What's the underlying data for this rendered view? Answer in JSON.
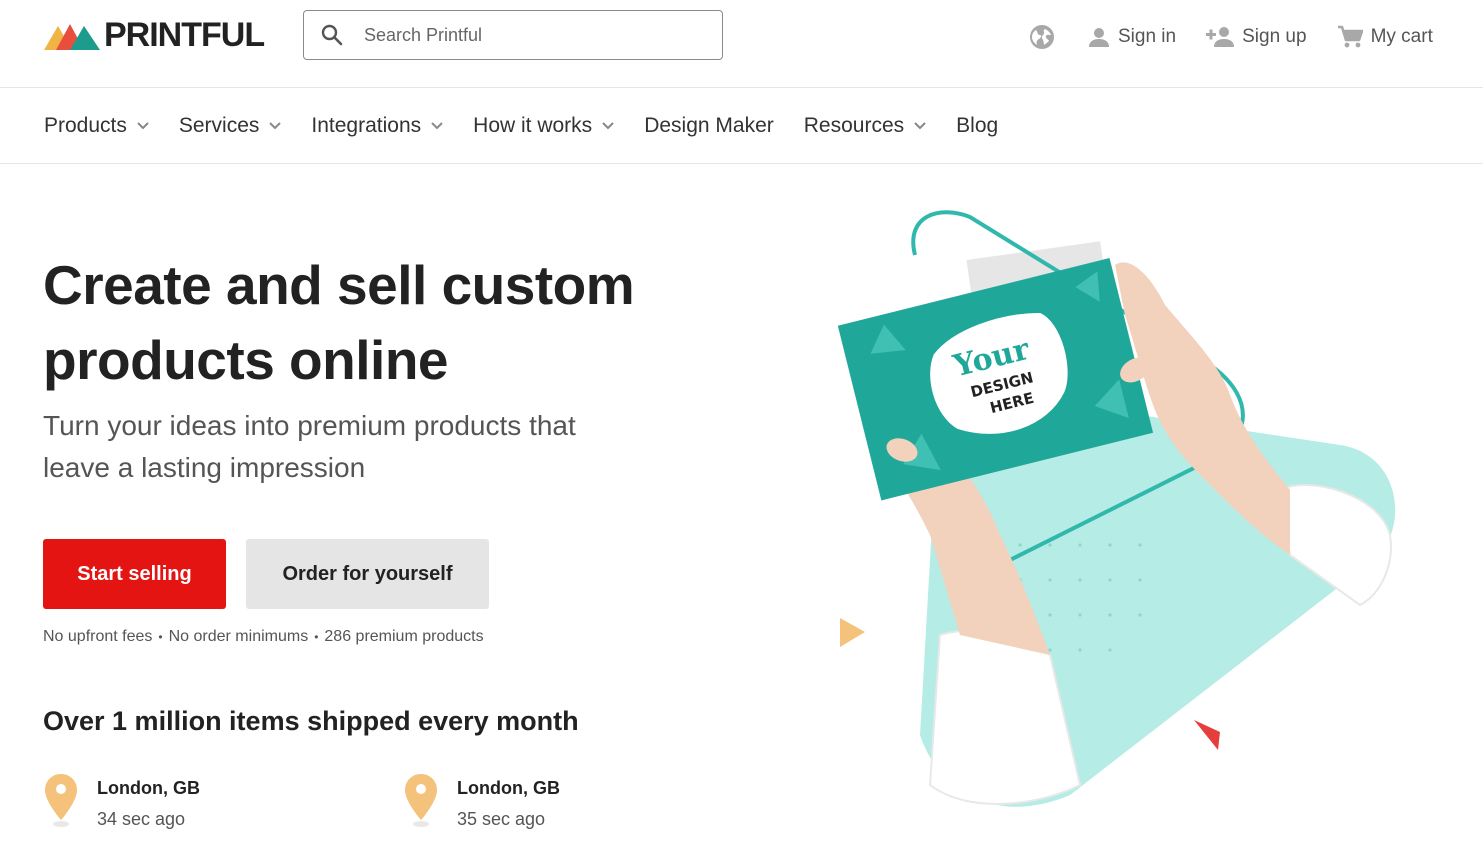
{
  "header": {
    "logo_text": "PRINTFUL",
    "search_placeholder": "Search Printful",
    "sign_in": "Sign in",
    "sign_up": "Sign up",
    "cart": "My cart"
  },
  "nav": {
    "items": [
      {
        "label": "Products",
        "dropdown": true
      },
      {
        "label": "Services",
        "dropdown": true
      },
      {
        "label": "Integrations",
        "dropdown": true
      },
      {
        "label": "How it works",
        "dropdown": true
      },
      {
        "label": "Design Maker",
        "dropdown": false
      },
      {
        "label": "Resources",
        "dropdown": true
      },
      {
        "label": "Blog",
        "dropdown": false
      }
    ]
  },
  "hero": {
    "title_line1": "Create and sell custom",
    "title_line2": "products online",
    "subtitle_line1": "Turn your ideas into premium products that",
    "subtitle_line2": "leave a lasting impression",
    "primary_button": "Start selling",
    "secondary_button": "Order for yourself",
    "features": [
      "No upfront fees",
      "No order minimums",
      "286 premium products"
    ],
    "feature_separator": "•",
    "image_card": {
      "word1": "Your",
      "word2": "DESIGN",
      "word3": "HERE"
    }
  },
  "shipped": {
    "heading": "Over 1 million items shipped every month",
    "locations": [
      {
        "city": "London, GB",
        "time": "34 sec ago"
      },
      {
        "city": "London, GB",
        "time": "35 sec ago"
      }
    ]
  },
  "colors": {
    "brand_red": "#e31411",
    "teal": "#1fa89a",
    "mint": "#b5ece6",
    "pin": "#f4c27a"
  }
}
